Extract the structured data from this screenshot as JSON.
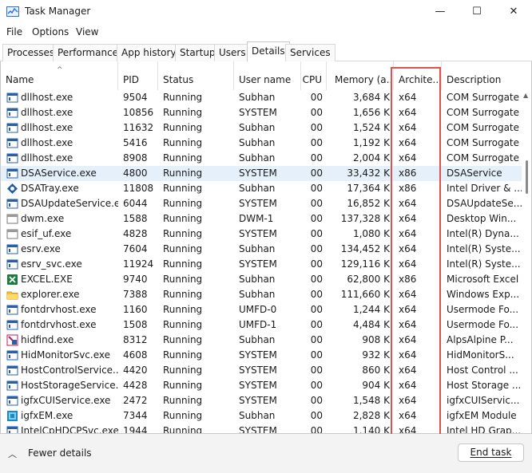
{
  "window": {
    "title": "Task Manager",
    "controls": {
      "minimize": "—",
      "maximize": "☐",
      "close": "✕"
    }
  },
  "menu": [
    "File",
    "Options",
    "View"
  ],
  "tabs": [
    "Processes",
    "Performance",
    "App history",
    "Startup",
    "Users",
    "Details",
    "Services"
  ],
  "active_tab": "Details",
  "columns": [
    "Name",
    "PID",
    "Status",
    "User name",
    "CPU",
    "Memory (a...",
    "Archite...",
    "Description"
  ],
  "highlight_color": "#d9534f",
  "selection_color": "#e5f0fb",
  "rows": [
    {
      "icon": "dllhost-icon",
      "name": "dllhost.exe",
      "pid": "9504",
      "status": "Running",
      "user": "Subhan",
      "cpu": "00",
      "memory": "3,684 K",
      "arch": "x64",
      "description": "COM Surrogate"
    },
    {
      "icon": "dllhost-icon",
      "name": "dllhost.exe",
      "pid": "10856",
      "status": "Running",
      "user": "SYSTEM",
      "cpu": "00",
      "memory": "1,656 K",
      "arch": "x64",
      "description": "COM Surrogate"
    },
    {
      "icon": "dllhost-icon",
      "name": "dllhost.exe",
      "pid": "11632",
      "status": "Running",
      "user": "Subhan",
      "cpu": "00",
      "memory": "1,524 K",
      "arch": "x64",
      "description": "COM Surrogate"
    },
    {
      "icon": "dllhost-icon",
      "name": "dllhost.exe",
      "pid": "5416",
      "status": "Running",
      "user": "Subhan",
      "cpu": "00",
      "memory": "1,192 K",
      "arch": "x64",
      "description": "COM Surrogate"
    },
    {
      "icon": "dllhost-icon",
      "name": "dllhost.exe",
      "pid": "8908",
      "status": "Running",
      "user": "Subhan",
      "cpu": "00",
      "memory": "2,004 K",
      "arch": "x64",
      "description": "COM Surrogate"
    },
    {
      "icon": "dsaservice-icon",
      "name": "DSAService.exe",
      "pid": "4800",
      "status": "Running",
      "user": "SYSTEM",
      "cpu": "00",
      "memory": "33,432 K",
      "arch": "x86",
      "description": "DSAService",
      "selected": true
    },
    {
      "icon": "dsatray-icon",
      "name": "DSATray.exe",
      "pid": "11808",
      "status": "Running",
      "user": "Subhan",
      "cpu": "00",
      "memory": "17,364 K",
      "arch": "x86",
      "description": "Intel Driver & ..."
    },
    {
      "icon": "dsaupdate-icon",
      "name": "DSAUpdateService.exe",
      "pid": "6044",
      "status": "Running",
      "user": "SYSTEM",
      "cpu": "00",
      "memory": "16,852 K",
      "arch": "x64",
      "description": "DSAUpdateSe..."
    },
    {
      "icon": "dwm-icon",
      "name": "dwm.exe",
      "pid": "1588",
      "status": "Running",
      "user": "DWM-1",
      "cpu": "00",
      "memory": "137,328 K",
      "arch": "x64",
      "description": "Desktop Win..."
    },
    {
      "icon": "esif-icon",
      "name": "esif_uf.exe",
      "pid": "4828",
      "status": "Running",
      "user": "SYSTEM",
      "cpu": "00",
      "memory": "1,080 K",
      "arch": "x64",
      "description": "Intel(R) Dyna..."
    },
    {
      "icon": "esrv-icon",
      "name": "esrv.exe",
      "pid": "7604",
      "status": "Running",
      "user": "Subhan",
      "cpu": "00",
      "memory": "134,452 K",
      "arch": "x64",
      "description": "Intel(R) Syste..."
    },
    {
      "icon": "esrv-svc-icon",
      "name": "esrv_svc.exe",
      "pid": "11924",
      "status": "Running",
      "user": "SYSTEM",
      "cpu": "00",
      "memory": "129,116 K",
      "arch": "x64",
      "description": "Intel(R) Syste..."
    },
    {
      "icon": "excel-icon",
      "name": "EXCEL.EXE",
      "pid": "9740",
      "status": "Running",
      "user": "Subhan",
      "cpu": "00",
      "memory": "62,800 K",
      "arch": "x86",
      "description": "Microsoft Excel"
    },
    {
      "icon": "explorer-icon",
      "name": "explorer.exe",
      "pid": "7388",
      "status": "Running",
      "user": "Subhan",
      "cpu": "00",
      "memory": "111,660 K",
      "arch": "x64",
      "description": "Windows Exp..."
    },
    {
      "icon": "fontdrvhost-icon",
      "name": "fontdrvhost.exe",
      "pid": "1160",
      "status": "Running",
      "user": "UMFD-0",
      "cpu": "00",
      "memory": "1,244 K",
      "arch": "x64",
      "description": "Usermode Fo..."
    },
    {
      "icon": "fontdrvhost-icon",
      "name": "fontdrvhost.exe",
      "pid": "1508",
      "status": "Running",
      "user": "UMFD-1",
      "cpu": "00",
      "memory": "4,484 K",
      "arch": "x64",
      "description": "Usermode Fo..."
    },
    {
      "icon": "hidfind-icon",
      "name": "hidfind.exe",
      "pid": "8312",
      "status": "Running",
      "user": "Subhan",
      "cpu": "00",
      "memory": "908 K",
      "arch": "x64",
      "description": "AlpsAlpine P..."
    },
    {
      "icon": "hidmonitor-icon",
      "name": "HidMonitorSvc.exe",
      "pid": "4608",
      "status": "Running",
      "user": "SYSTEM",
      "cpu": "00",
      "memory": "932 K",
      "arch": "x64",
      "description": "HidMonitorS..."
    },
    {
      "icon": "hostcontrol-icon",
      "name": "HostControlService....",
      "pid": "4420",
      "status": "Running",
      "user": "SYSTEM",
      "cpu": "00",
      "memory": "860 K",
      "arch": "x64",
      "description": "Host Control ..."
    },
    {
      "icon": "hoststorage-icon",
      "name": "HostStorageService....",
      "pid": "4428",
      "status": "Running",
      "user": "SYSTEM",
      "cpu": "00",
      "memory": "904 K",
      "arch": "x64",
      "description": "Host Storage ..."
    },
    {
      "icon": "igfxcui-icon",
      "name": "igfxCUIService.exe",
      "pid": "2472",
      "status": "Running",
      "user": "SYSTEM",
      "cpu": "00",
      "memory": "1,548 K",
      "arch": "x64",
      "description": "igfxCUIServic..."
    },
    {
      "icon": "igfxem-icon",
      "name": "igfxEM.exe",
      "pid": "7344",
      "status": "Running",
      "user": "Subhan",
      "cpu": "00",
      "memory": "2,828 K",
      "arch": "x64",
      "description": "igfxEM Module"
    },
    {
      "icon": "intelcphdcp-icon",
      "name": "IntelCpHDCPSvc.exe",
      "pid": "1944",
      "status": "Running",
      "user": "SYSTEM",
      "cpu": "00",
      "memory": "1,140 K",
      "arch": "x64",
      "description": "Intel HD Grap..."
    }
  ],
  "footer": {
    "fewer_details": "Fewer details",
    "end_task": "End task"
  }
}
